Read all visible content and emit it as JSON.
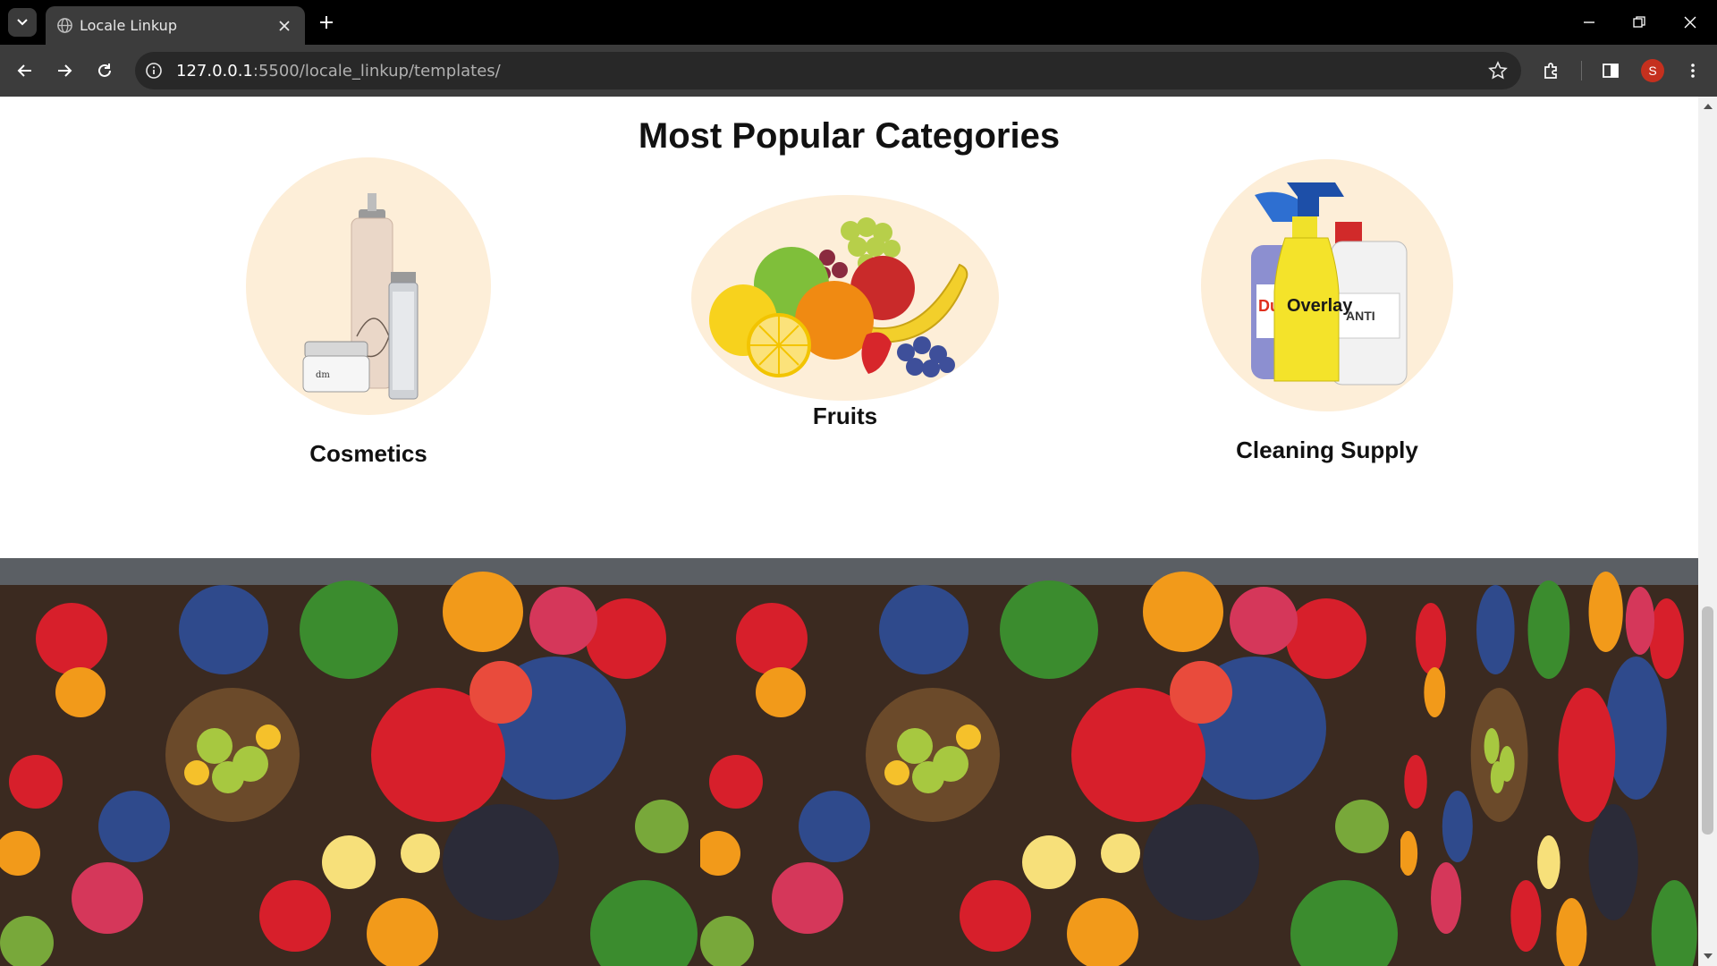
{
  "browser": {
    "tab_title": "Locale Linkup",
    "url_host": "127.0.0.1",
    "url_path": ":5500/locale_linkup/templates/",
    "profile_initial": "S"
  },
  "page": {
    "section_title": "Most Popular Categories",
    "categories": [
      {
        "label": "Cosmetics",
        "icon": "cosmetics-products-image"
      },
      {
        "label": "Fruits",
        "icon": "fruits-image"
      },
      {
        "label": "Cleaning Supply",
        "icon": "cleaning-supply-image"
      }
    ],
    "banner": {
      "icon": "fruit-banner-image",
      "tiles": 3
    }
  },
  "colors": {
    "category_bg": "#fdeed8",
    "chrome_dark": "#3c3c3c",
    "title_text": "#111111"
  }
}
